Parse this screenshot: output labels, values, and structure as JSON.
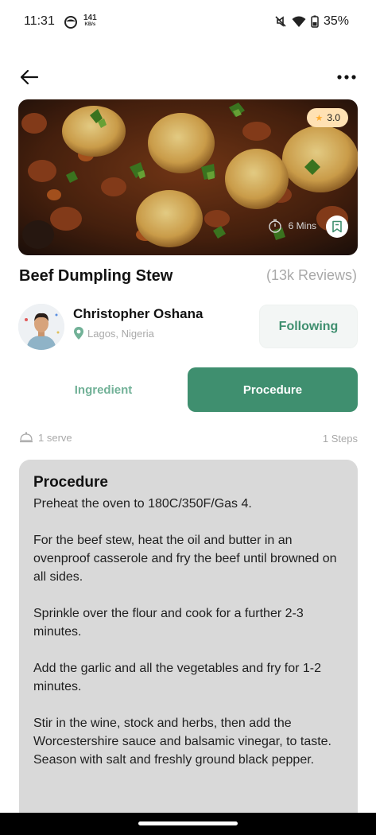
{
  "status": {
    "time": "11:31",
    "net_speed": "141",
    "net_unit": "KB/s",
    "battery": "35%"
  },
  "recipe": {
    "title": "Beef Dumpling Stew",
    "reviews": "(13k Reviews)",
    "rating": "3.0",
    "time": "6 Mins"
  },
  "author": {
    "name": "Christopher Oshana",
    "location": "Lagos, Nigeria",
    "follow_label": "Following"
  },
  "tabs": {
    "ingredient": "Ingredient",
    "procedure": "Procedure"
  },
  "meta": {
    "serve": "1 serve",
    "steps": "1 Steps"
  },
  "procedure": {
    "title": "Procedure",
    "steps": [
      "Preheat the oven to 180C/350F/Gas 4.",
      "For the beef stew, heat the oil and butter in an ovenproof casserole and fry the beef until browned on all sides.",
      "Sprinkle over the flour and cook for a further 2-3 minutes.",
      "Add the garlic and all the vegetables and fry for 1-2 minutes.",
      "Stir in the wine, stock and herbs, then add the Worcestershire sauce and balsamic vinegar, to taste. Season with salt and freshly ground black pepper."
    ]
  },
  "colors": {
    "primary": "#3f8f6f",
    "primary_light": "#71b197",
    "rating_badge": "#ffe1b3",
    "star": "#ffad30",
    "card": "#d9d9d9",
    "muted_text": "#a9a9a9"
  },
  "icons": [
    "back-arrow-icon",
    "more-dots-icon",
    "star-icon",
    "timer-icon",
    "bookmark-icon",
    "location-pin-icon",
    "serve-dish-icon"
  ]
}
